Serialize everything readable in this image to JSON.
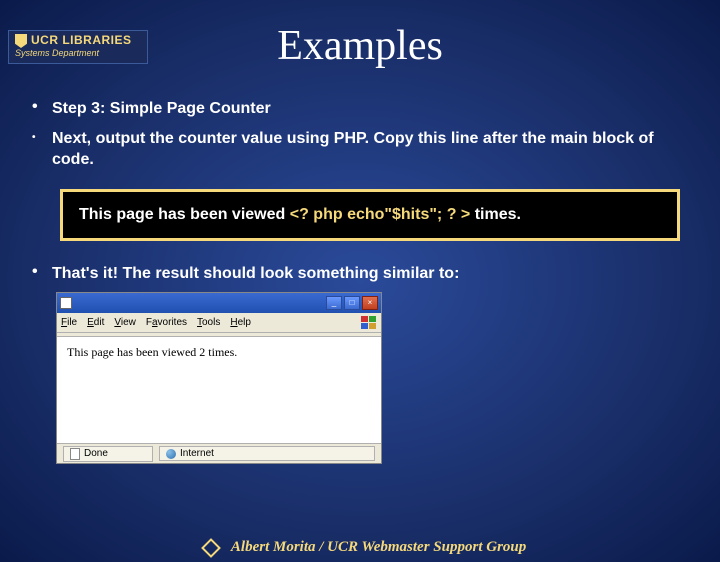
{
  "logo": {
    "main": "UCR LIBRARIES",
    "sub": "Systems Department"
  },
  "title": "Examples",
  "bullets": {
    "step": "Step 3: Simple Page Counter",
    "instruction": "Next, output the counter value using PHP. Copy this line after the main block of code.",
    "result": "That's it! The result should look something similar to:"
  },
  "code_box": {
    "prefix": "This page has been viewed ",
    "php": "<? php echo\"$hits\"; ? >",
    "suffix": " times."
  },
  "browser": {
    "menu": {
      "file": "File",
      "edit": "Edit",
      "view": "View",
      "favorites": "Favorites",
      "tools": "Tools",
      "help": "Help"
    },
    "body_text": "This page has been viewed 2 times.",
    "status": {
      "done": "Done",
      "zone": "Internet"
    }
  },
  "footer": "Albert Morita / UCR Webmaster Support Group"
}
